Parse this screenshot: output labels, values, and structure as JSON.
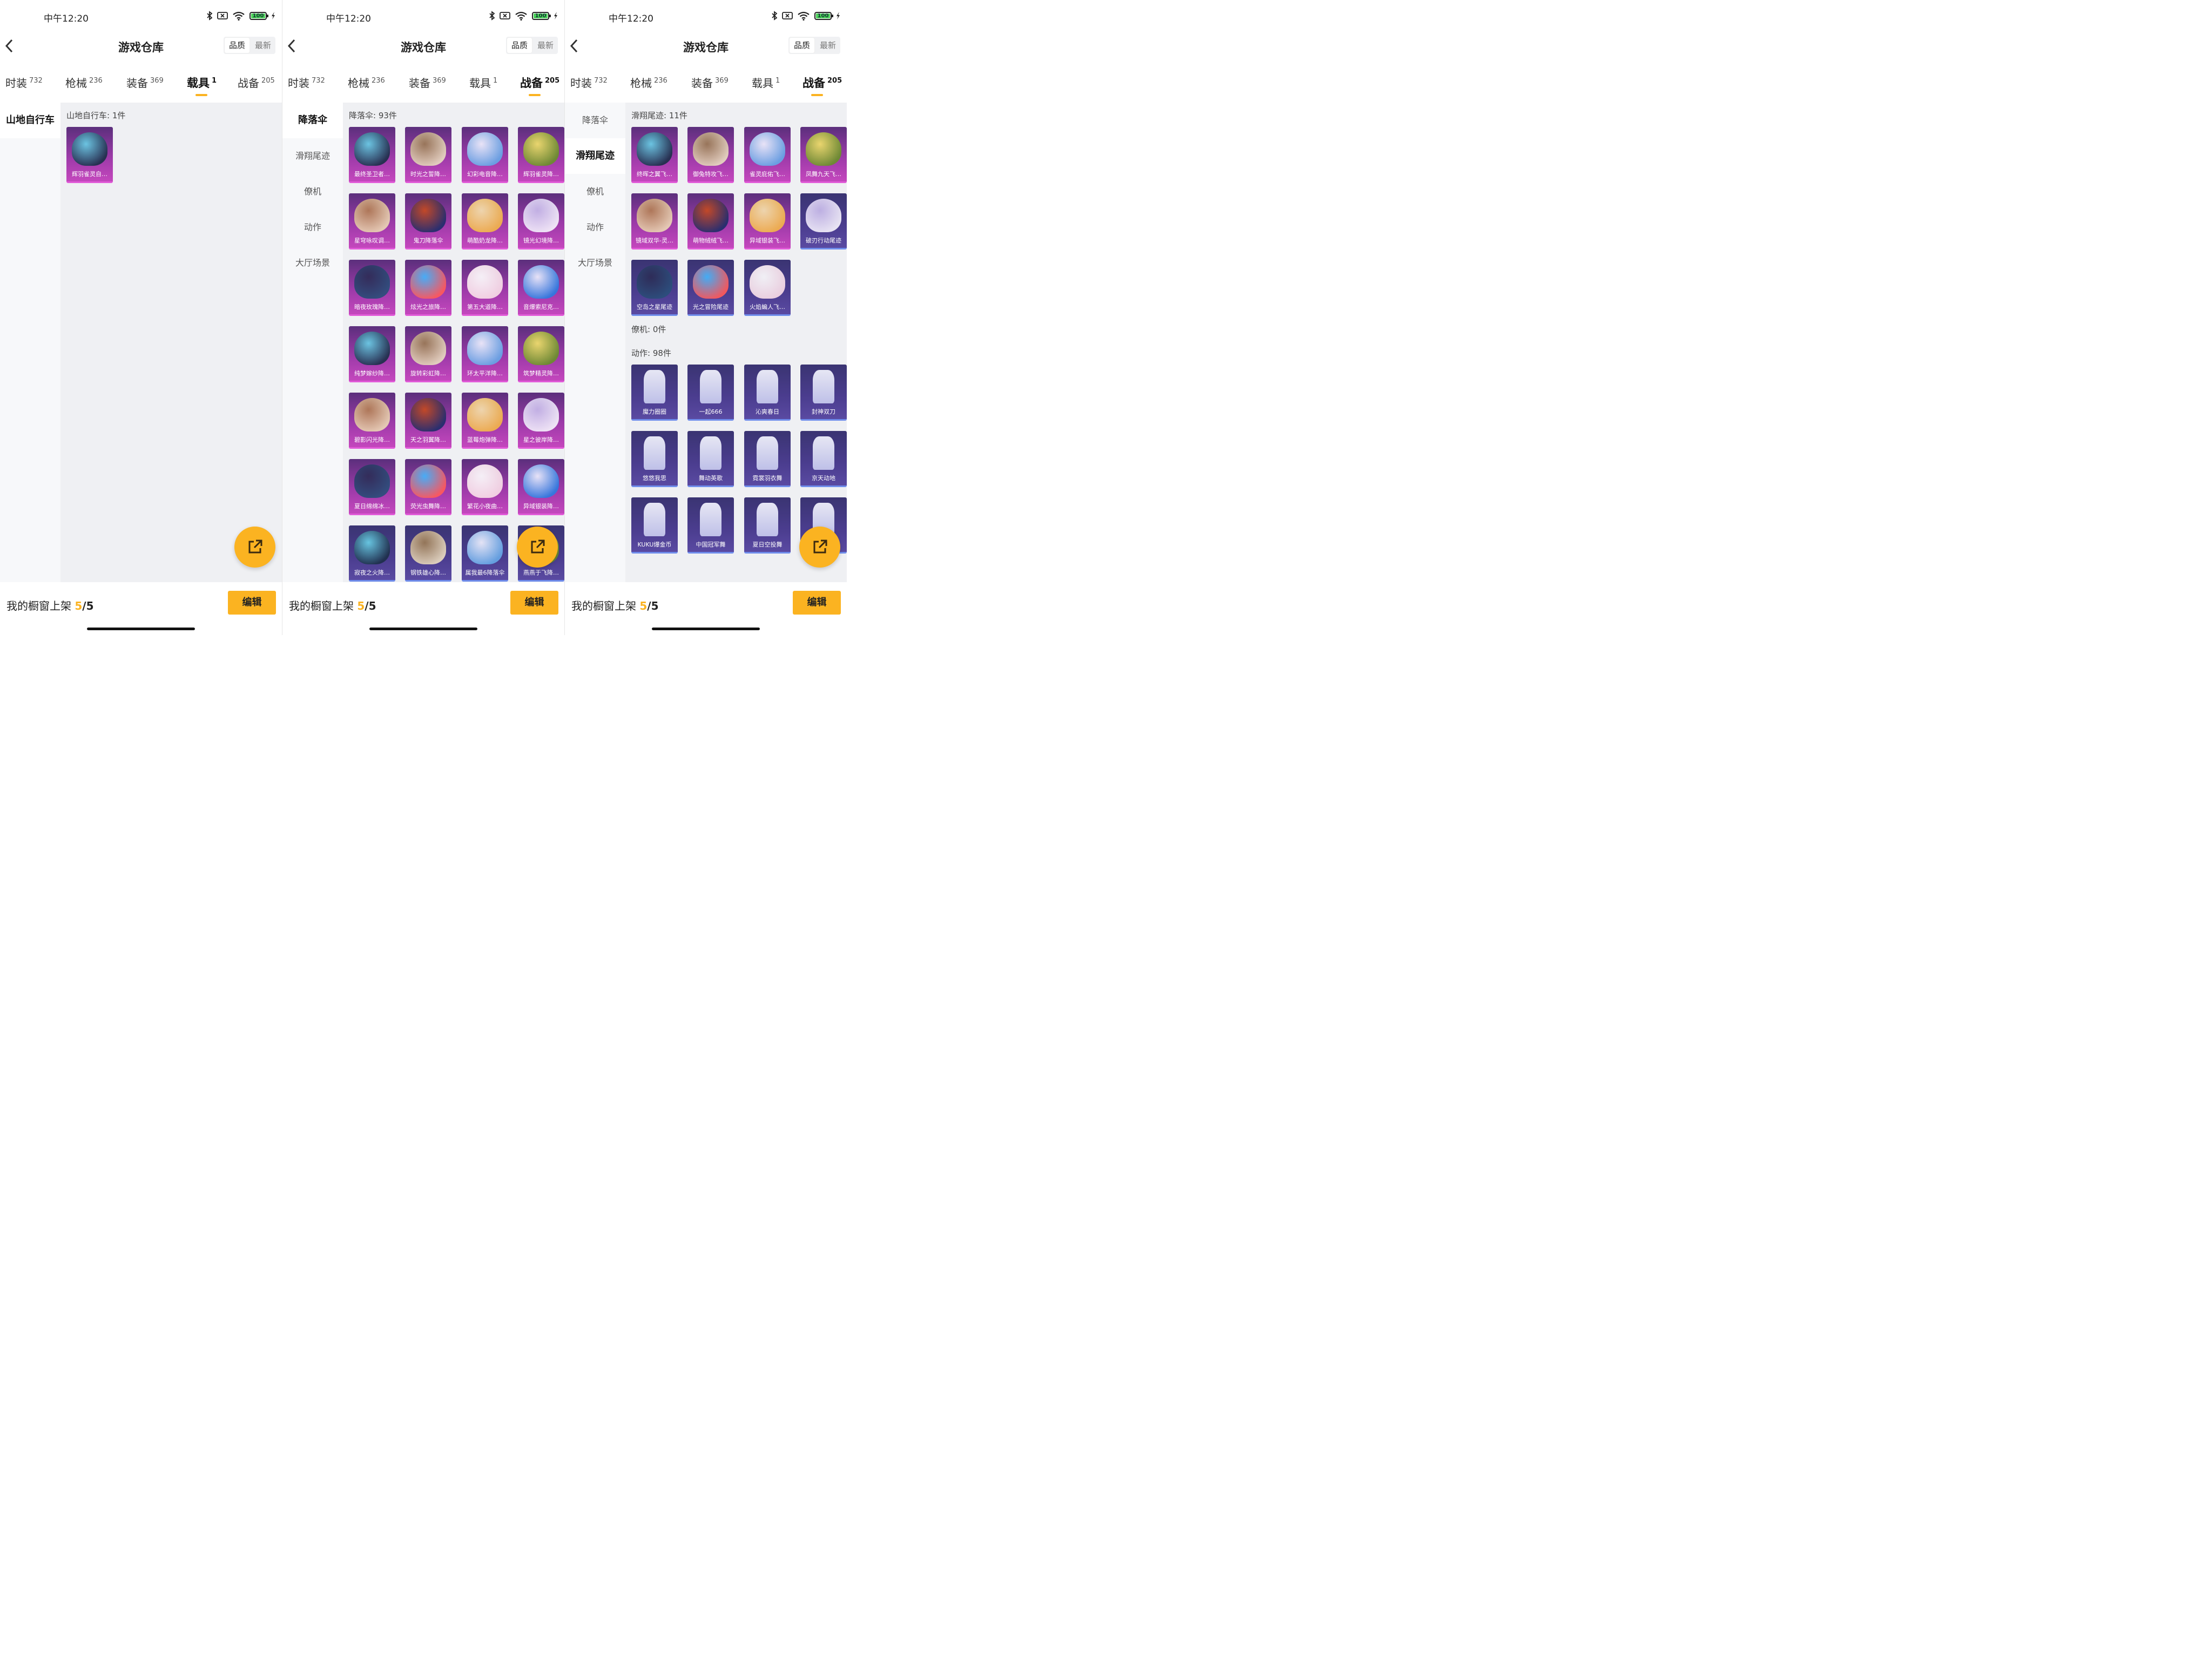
{
  "status": {
    "time": "中午12:20",
    "battery": "100"
  },
  "header": {
    "title": "游戏仓库",
    "sort_quality": "品质",
    "sort_latest": "最新"
  },
  "tabs": [
    {
      "label": "时装",
      "count": "732"
    },
    {
      "label": "枪械",
      "count": "236"
    },
    {
      "label": "装备",
      "count": "369"
    },
    {
      "label": "载具",
      "count": "1"
    },
    {
      "label": "战备",
      "count": "205"
    }
  ],
  "panel1": {
    "active_tab": 3,
    "sidebar": [
      "山地自行车"
    ],
    "section_label": "山地自行车: 1件",
    "items": [
      {
        "label": "辉羽雀灵自…"
      }
    ]
  },
  "panel2": {
    "active_tab": 4,
    "sidebar": [
      "降落伞",
      "滑翔尾迹",
      "僚机",
      "动作",
      "大厅场景"
    ],
    "section_label": "降落伞: 93件",
    "items": [
      {
        "label": "最终圣卫者…"
      },
      {
        "label": "时光之誓降…"
      },
      {
        "label": "幻彩电音降…"
      },
      {
        "label": "辉羽雀灵降…"
      },
      {
        "label": "星穹咏叹调…"
      },
      {
        "label": "鬼刀降落伞"
      },
      {
        "label": "萌酷奶龙降…"
      },
      {
        "label": "镜光幻境降…"
      },
      {
        "label": "暗夜玫瑰降…"
      },
      {
        "label": "炫光之旅降…"
      },
      {
        "label": "第五大道降…"
      },
      {
        "label": "音爆索尼克…"
      },
      {
        "label": "纯梦嫁纱降…"
      },
      {
        "label": "旋转彩虹降…"
      },
      {
        "label": "环太平洋降…"
      },
      {
        "label": "筑梦精灵降…"
      },
      {
        "label": "碧影闪光降…"
      },
      {
        "label": "天之羽翼降…"
      },
      {
        "label": "蓝莓炮弹降…"
      },
      {
        "label": "星之彼岸降…"
      },
      {
        "label": "夏日绵绵冰…"
      },
      {
        "label": "荧光虫舞降…"
      },
      {
        "label": "繁花小夜曲…"
      },
      {
        "label": "异域银装降…"
      },
      {
        "label": "寂夜之火降…"
      },
      {
        "label": "钢铁雄心降…"
      },
      {
        "label": "属我最6降落伞"
      },
      {
        "label": "燕燕于飞降…"
      }
    ]
  },
  "panel3": {
    "active_tab": 4,
    "sidebar": [
      "降落伞",
      "滑翔尾迹",
      "僚机",
      "动作",
      "大厅场景"
    ],
    "trail_label": "滑翔尾迹: 11件",
    "trail_items": [
      {
        "label": "终晖之翼飞…"
      },
      {
        "label": "御兔特攻飞…"
      },
      {
        "label": "雀灵庇佑飞…"
      },
      {
        "label": "凤舞九天飞…"
      },
      {
        "label": "镜域双华-灵…"
      },
      {
        "label": "萌物绒绒飞…"
      },
      {
        "label": "异域银装飞…"
      },
      {
        "label": "破刃行动尾迹"
      },
      {
        "label": "空岛之星尾迹"
      },
      {
        "label": "光之冒险尾迹"
      },
      {
        "label": "火焰蝙人飞…"
      }
    ],
    "wingman_label": "僚机: 0件",
    "emote_label": "动作: 98件",
    "emote_items": [
      {
        "label": "魔力圈圈"
      },
      {
        "label": "一起666"
      },
      {
        "label": "沁爽春日"
      },
      {
        "label": "封神双刀"
      },
      {
        "label": "悠悠我思"
      },
      {
        "label": "舞动英歌"
      },
      {
        "label": "霓裳羽衣舞"
      },
      {
        "label": "京天动地"
      },
      {
        "label": "KUKU爆金币"
      },
      {
        "label": "中国冠军舞"
      },
      {
        "label": "夏日空投舞"
      },
      {
        "label": ""
      }
    ]
  },
  "bottom": {
    "shop_label": "我的橱窗上架",
    "shop_count": "5",
    "shop_total": "/5",
    "edit_label": "编辑"
  }
}
